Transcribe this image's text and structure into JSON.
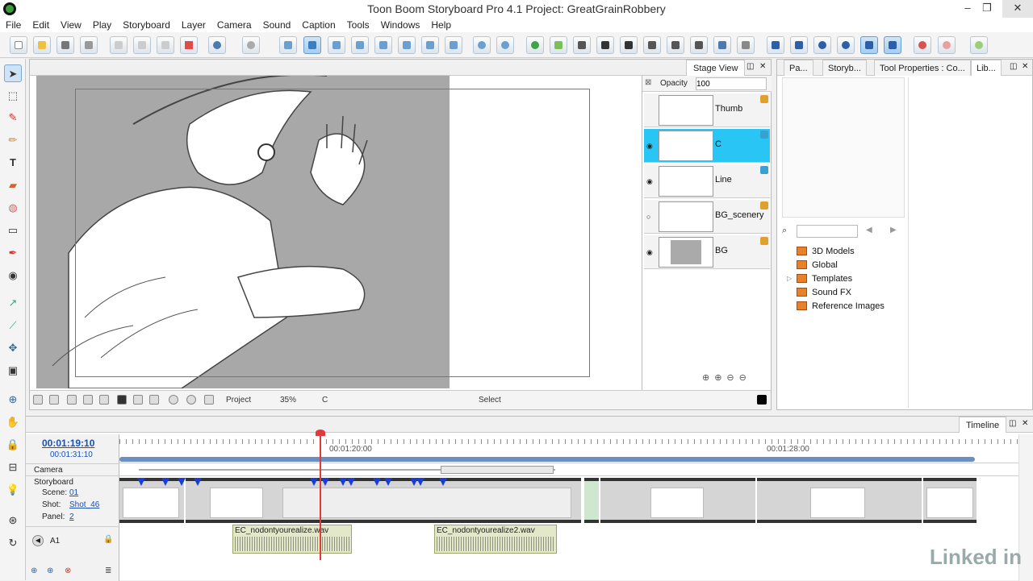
{
  "window": {
    "title": "Toon Boom Storyboard Pro 4.1 Project: GreatGrainRobbery",
    "minimize": "–",
    "maximize": "❐",
    "close": "✕"
  },
  "menu": [
    "File",
    "Edit",
    "View",
    "Play",
    "Storyboard",
    "Layer",
    "Camera",
    "Sound",
    "Caption",
    "Tools",
    "Windows",
    "Help"
  ],
  "stage": {
    "tab": "Stage View",
    "opacity_label": "Opacity",
    "opacity_value": "100",
    "status": {
      "project": "Project",
      "zoom": "35%",
      "layer": "C",
      "tool": "Select"
    },
    "layers": [
      {
        "name": "Thumb",
        "selected": false
      },
      {
        "name": "C",
        "selected": true
      },
      {
        "name": "Line",
        "selected": false
      },
      {
        "name": "BG_scenery",
        "selected": false
      },
      {
        "name": "BG",
        "selected": false
      }
    ]
  },
  "right_panel": {
    "tabs": [
      "Pa...",
      "Storyb...",
      "Tool Properties : Co...",
      "Lib..."
    ],
    "library": [
      "3D Models",
      "Global",
      "Templates",
      "Sound FX",
      "Reference Images"
    ]
  },
  "timeline": {
    "tab": "Timeline",
    "current_time": "00:01:19:10",
    "total_time": "00:01:31:10",
    "ruler_labels": [
      "00:01:20:00",
      "00:01:28:00"
    ],
    "camera_label": "Camera",
    "storyboard_label": "Storyboard",
    "scene_label": "Scene:",
    "scene_value": "01",
    "shot_label": "Shot:",
    "shot_value": "Shot_46",
    "panel_label": "Panel:",
    "panel_value": "2",
    "audio_track": "A1",
    "audio_clips": [
      "EC_nodontyourealize.wav",
      "EC_nodontyourealize2.wav"
    ]
  },
  "watermark": "Linked in"
}
